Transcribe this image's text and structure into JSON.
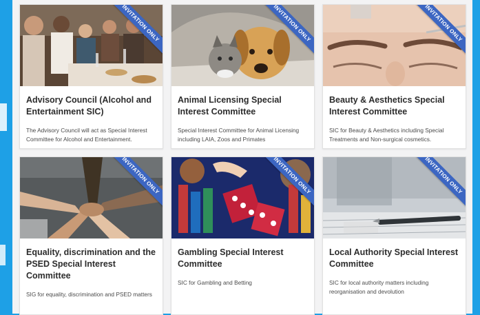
{
  "ribbon_label": "INVITATION ONLY",
  "colors": {
    "accent": "#1ea0e6",
    "ribbon": "#3c66c2"
  },
  "cards": [
    {
      "title": "Advisory Council (Alcohol and Entertainment SIC)",
      "description": "The Advisory Council will act as Special Interest Committee for Alcohol and Entertainment."
    },
    {
      "title": "Animal Licensing Special Interest Committee",
      "description": "Special Interest Committee for Animal Licensing including LAIA, Zoos and Primates"
    },
    {
      "title": "Beauty & Aesthetics Special Interest Committee",
      "description": "SIC for Beauty & Aesthetics including Special Treatments and Non-surgical cosmetics."
    },
    {
      "title": "Equality, discrimination and the PSED Special Interest Committee",
      "description": "SIG for equality, discrimination and PSED matters"
    },
    {
      "title": "Gambling Special Interest Committee",
      "description": "SIC for Gambling and Betting"
    },
    {
      "title": "Local Authority Special Interest Committee",
      "description": "SIC for local authority matters including reorganisation and devolution"
    }
  ]
}
